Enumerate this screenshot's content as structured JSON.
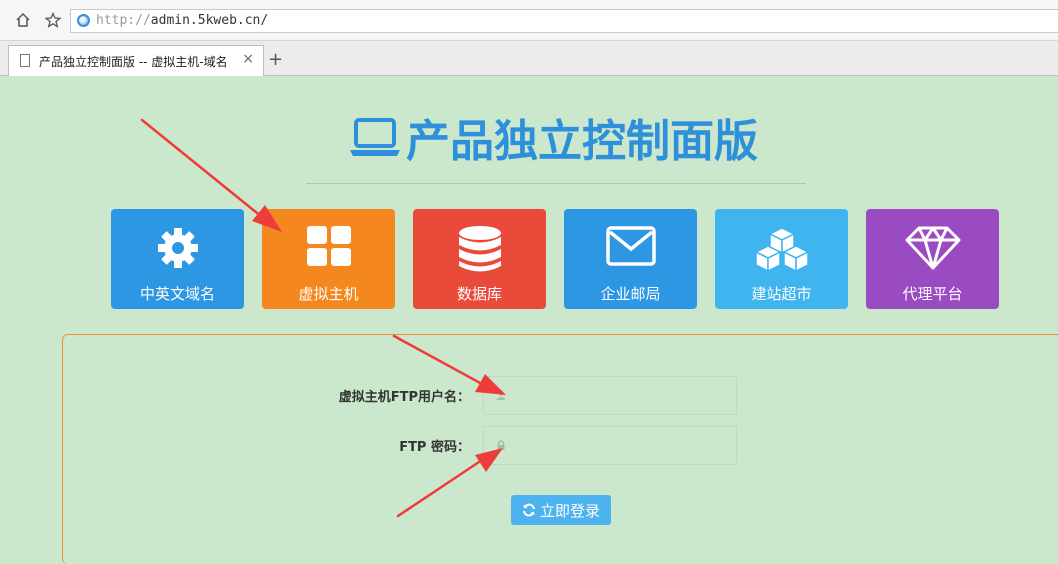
{
  "browser": {
    "url_prefix": "http://",
    "url_host": "admin.5kweb.cn/",
    "tab_title": "产品独立控制面版 -- 虚拟主机-域名",
    "tab_close": "×",
    "new_tab": "+"
  },
  "page": {
    "title": "产品独立控制面版"
  },
  "tiles": [
    {
      "label": "中英文域名",
      "icon": "gear-icon",
      "color": "#2d97e3"
    },
    {
      "label": "虚拟主机",
      "icon": "grid-icon",
      "color": "#f5871f"
    },
    {
      "label": "数据库",
      "icon": "database-icon",
      "color": "#e94a3a"
    },
    {
      "label": "企业邮局",
      "icon": "envelope-icon",
      "color": "#2d97e3"
    },
    {
      "label": "建站超市",
      "icon": "cubes-icon",
      "color": "#3fb4ee"
    },
    {
      "label": "代理平台",
      "icon": "diamond-icon",
      "color": "#9b4bc1"
    }
  ],
  "login": {
    "username_label": "虚拟主机FTP用户名：",
    "username_value": "",
    "password_label": "FTP 密码：",
    "password_value": "",
    "submit_label": "立即登录"
  },
  "colors": {
    "background": "#cbe7cc",
    "title": "#2e8fda",
    "panel_border": "#f08a3c",
    "button": "#4db3ef",
    "annotation_arrow": "#ee3b3b"
  }
}
